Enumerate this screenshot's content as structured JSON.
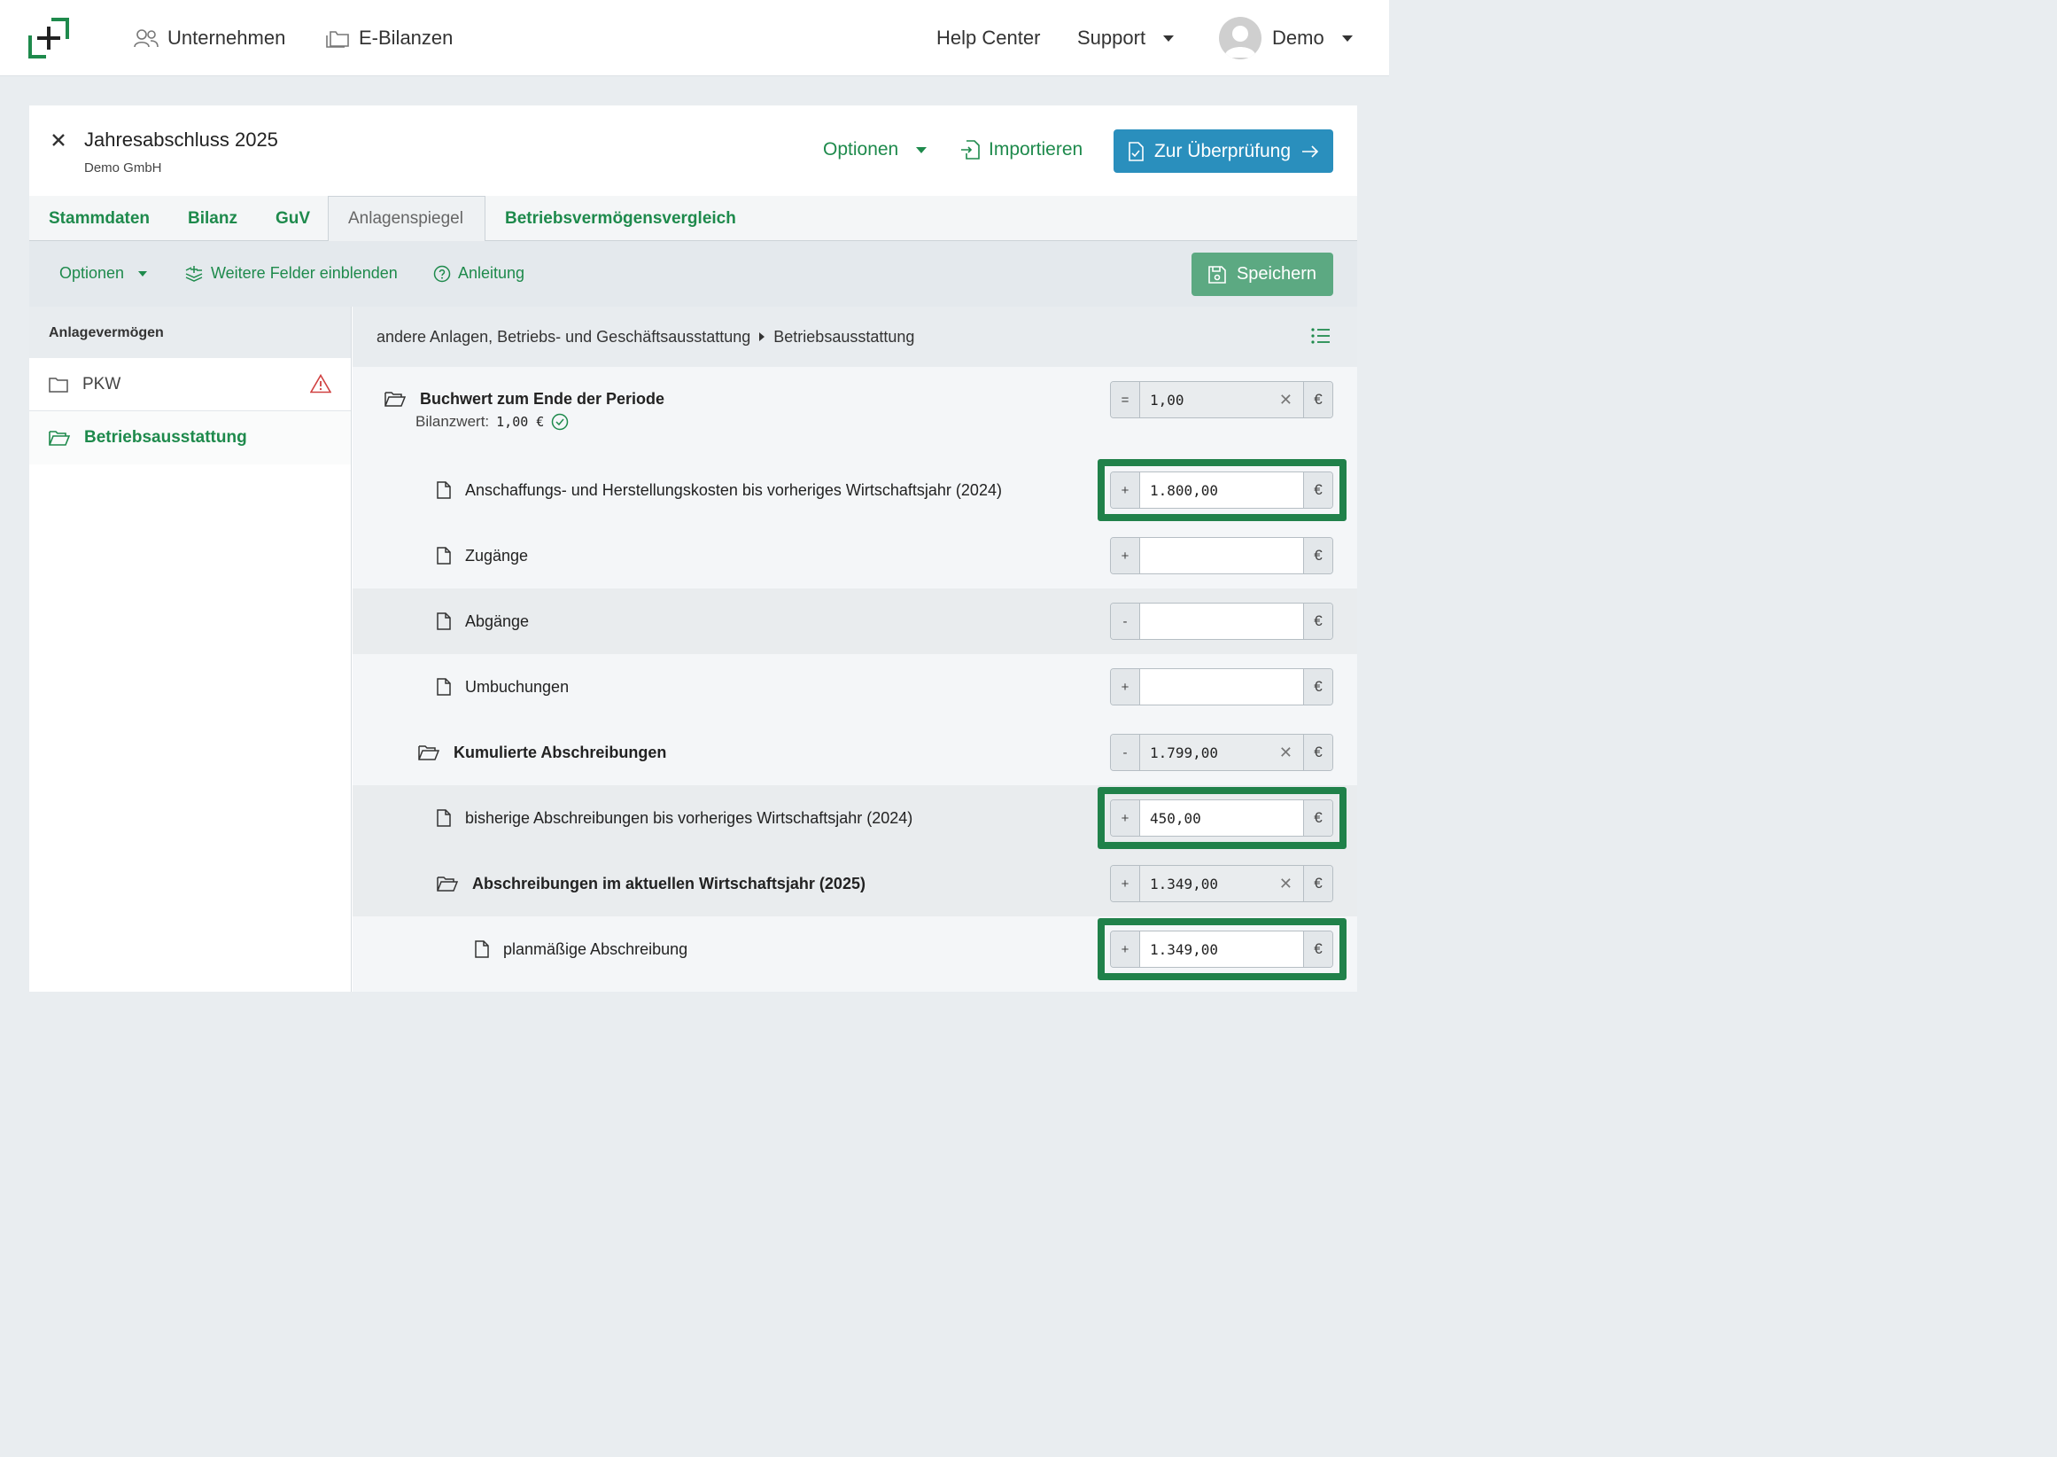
{
  "nav": {
    "unternehmen": "Unternehmen",
    "e_bilanzen": "E-Bilanzen",
    "help_center": "Help Center",
    "support": "Support",
    "user": "Demo"
  },
  "header": {
    "title": "Jahresabschluss 2025",
    "subtitle": "Demo GmbH",
    "optionen": "Optionen",
    "importieren": "Importieren",
    "review": "Zur Überprüfung"
  },
  "tabs": [
    "Stammdaten",
    "Bilanz",
    "GuV",
    "Anlagenspiegel",
    "Betriebsvermögensvergleich"
  ],
  "toolbar": {
    "optionen": "Optionen",
    "weitere": "Weitere Felder einblenden",
    "anleitung": "Anleitung",
    "save": "Speichern"
  },
  "sidebar": {
    "heading": "Anlagevermögen",
    "items": [
      {
        "label": "PKW"
      },
      {
        "label": "Betriebsausstattung"
      }
    ]
  },
  "breadcrumb": {
    "parent": "andere Anlagen, Betriebs- und Geschäftsausstattung",
    "current": "Betriebsausstattung"
  },
  "rows": [
    {
      "label": "Buchwert zum Ende der Periode",
      "sign": "=",
      "value": "1,00",
      "sub_label": "Bilanzwert:",
      "sub_value": "1,00 €"
    },
    {
      "label": "Anschaffungs- und Herstellungskosten bis vorheriges Wirtschaftsjahr (2024)",
      "sign": "+",
      "value": "1.800,00"
    },
    {
      "label": "Zugänge",
      "sign": "+",
      "value": ""
    },
    {
      "label": "Abgänge",
      "sign": "-",
      "value": ""
    },
    {
      "label": "Umbuchungen",
      "sign": "+",
      "value": ""
    },
    {
      "label": "Kumulierte Abschreibungen",
      "sign": "-",
      "value": "1.799,00"
    },
    {
      "label": "bisherige Abschreibungen bis vorheriges Wirtschaftsjahr (2024)",
      "sign": "+",
      "value": "450,00"
    },
    {
      "label": "Abschreibungen im aktuellen Wirtschaftsjahr (2025)",
      "sign": "+",
      "value": "1.349,00"
    },
    {
      "label": "planmäßige Abschreibung",
      "sign": "+",
      "value": "1.349,00"
    }
  ],
  "currency": "€",
  "colors": {
    "brand_green": "#1e8a4c",
    "highlight": "#20814a",
    "primary_blue": "#2a8fbd",
    "save_green": "#5ca982"
  }
}
